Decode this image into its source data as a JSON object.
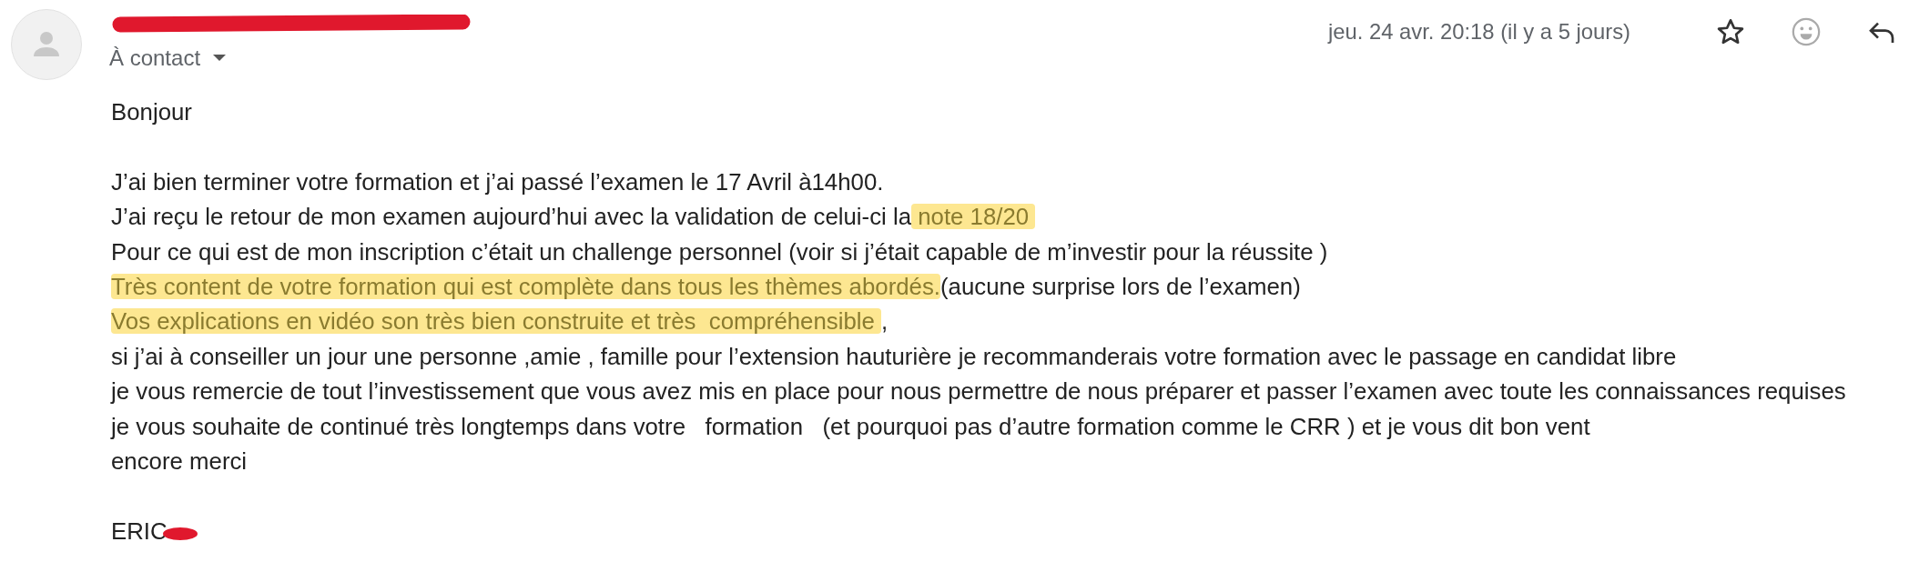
{
  "header": {
    "sender": {
      "redacted": true
    },
    "recipient": "À contact",
    "date": "jeu. 24 avr. 20:18 (il y a 5 jours)",
    "starred": false
  },
  "body": [
    {
      "segments": [
        {
          "text": "Bonjour",
          "highlighted": false
        }
      ]
    },
    {
      "segments": [
        {
          "text": "J’ai bien terminer votre formation et j’ai passé l’examen le 17 Avril à14h00.",
          "highlighted": false
        }
      ]
    },
    {
      "segments": [
        {
          "text": "J’ai reçu le retour de mon examen aujourd’hui avec la validation de celui-ci la",
          "highlighted": false
        },
        {
          "text": " note 18/20 ",
          "highlighted": true
        }
      ]
    },
    {
      "segments": [
        {
          "text": "Pour ce qui est de mon inscription c’était un challenge personnel (voir si j’était capable de m’investir pour la réussite )",
          "highlighted": false
        }
      ]
    },
    {
      "segments": [
        {
          "text": "Très content de votre formation qui est complète dans tous les thèmes abordés.",
          "highlighted": true
        },
        {
          "text": "(aucune surprise lors de l’examen)",
          "highlighted": false
        }
      ]
    },
    {
      "segments": [
        {
          "text": "Vos explications en vidéo son très bien construite et très  compréhensible ",
          "highlighted": true
        },
        {
          "text": ",",
          "highlighted": false
        }
      ]
    },
    {
      "segments": [
        {
          "text": "si j’ai à conseiller un jour une personne ,amie , famille pour l’extension hauturière je recommanderais votre formation avec le passage en candidat libre",
          "highlighted": false
        }
      ]
    },
    {
      "segments": [
        {
          "text": "je vous remercie de tout l’investissement que vous avez mis en place pour nous permettre de nous préparer et passer l’examen avec toute les connaissances requises",
          "highlighted": false
        }
      ]
    },
    {
      "segments": [
        {
          "text": "je vous souhaite de continué très longtemps dans votre   formation   (et pourquoi pas d’autre formation comme le CRR ) et je vous dit bon vent",
          "highlighted": false
        }
      ]
    },
    {
      "segments": [
        {
          "text": "encore merci",
          "highlighted": false
        }
      ]
    }
  ],
  "signature": {
    "text": "ERIC",
    "redacted": true
  }
}
